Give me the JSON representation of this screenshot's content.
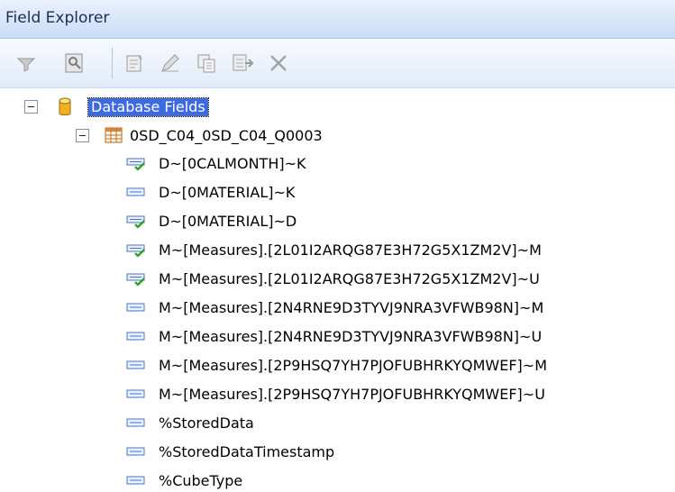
{
  "panel": {
    "title": "Field Explorer"
  },
  "toolbar": {
    "buttons": [
      {
        "icon": "filter-icon"
      },
      {
        "icon": "browse-data-icon"
      },
      {
        "icon": "insert-field-icon"
      },
      {
        "icon": "edit-icon"
      },
      {
        "icon": "copy-icon"
      },
      {
        "icon": "rename-icon"
      },
      {
        "icon": "delete-icon"
      }
    ]
  },
  "tree": {
    "root": {
      "label": "Database Fields",
      "icon": "database-icon",
      "expanded": true,
      "selected": true
    },
    "table": {
      "label": "0SD_C04_0SD_C04_Q0003",
      "icon": "table-icon",
      "expanded": true
    },
    "fields": [
      {
        "label": "D~[0CALMONTH]~K",
        "used": true
      },
      {
        "label": "D~[0MATERIAL]~K",
        "used": false
      },
      {
        "label": "D~[0MATERIAL]~D",
        "used": true
      },
      {
        "label": "M~[Measures].[2L01I2ARQG87E3H72G5X1ZM2V]~M",
        "used": true
      },
      {
        "label": "M~[Measures].[2L01I2ARQG87E3H72G5X1ZM2V]~U",
        "used": true
      },
      {
        "label": "M~[Measures].[2N4RNE9D3TYVJ9NRA3VFWB98N]~M",
        "used": false
      },
      {
        "label": "M~[Measures].[2N4RNE9D3TYVJ9NRA3VFWB98N]~U",
        "used": false
      },
      {
        "label": "M~[Measures].[2P9HSQ7YH7PJOFUBHRKYQMWEF]~M",
        "used": false
      },
      {
        "label": "M~[Measures].[2P9HSQ7YH7PJOFUBHRKYQMWEF]~U",
        "used": false
      },
      {
        "label": "%StoredData",
        "used": false
      },
      {
        "label": "%StoredDataTimestamp",
        "used": false
      },
      {
        "label": "%CubeType",
        "used": false
      }
    ]
  },
  "colors": {
    "selection": "#3e6ae0",
    "title_text": "#1c2e55",
    "check": "#2ea12e"
  }
}
